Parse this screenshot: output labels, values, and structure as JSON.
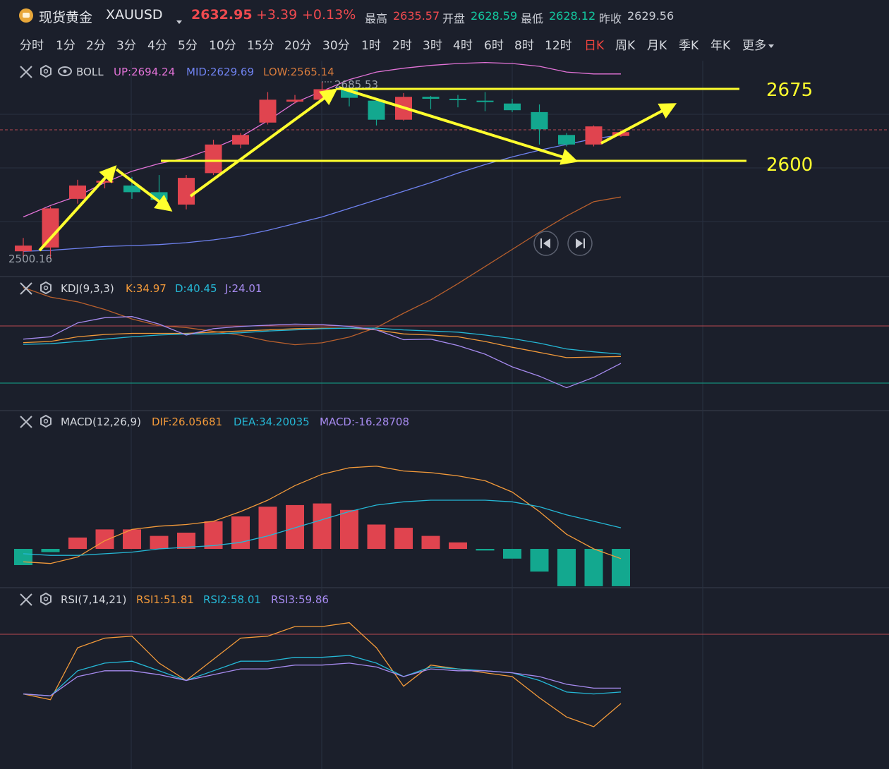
{
  "header": {
    "symbol_name": "现货黄金",
    "symbol_code": "XAUUSD",
    "price": "2632.95",
    "change": "+3.39",
    "change_pct": "+0.13%",
    "high_label": "最高",
    "high": "2635.57",
    "open_label": "开盘",
    "open": "2628.59",
    "low_label": "最低",
    "low": "2628.12",
    "prev_label": "昨收",
    "prev": "2629.56"
  },
  "periods": [
    "分时",
    "1分",
    "2分",
    "3分",
    "4分",
    "5分",
    "10分",
    "15分",
    "20分",
    "30分",
    "1时",
    "2时",
    "3时",
    "4时",
    "6时",
    "8时",
    "12时",
    "日K",
    "周K",
    "月K",
    "季K",
    "年K",
    "更多"
  ],
  "active_period": "日K",
  "colors": {
    "up": "#e0444f",
    "down": "#13a88f",
    "annotation": "#ffff2e",
    "background": "#1b1f2b"
  },
  "panels": {
    "boll": {
      "name": "BOLL",
      "up": "UP:2694.24",
      "mid": "MID:2629.69",
      "low": "LOW:2565.14"
    },
    "kdj": {
      "name": "KDJ(9,3,3)",
      "k": "K:34.97",
      "d": "D:40.45",
      "j": "J:24.01"
    },
    "macd": {
      "name": "MACD(12,26,9)",
      "dif": "DIF:26.05681",
      "dea": "DEA:34.20035",
      "macd": "MACD:-16.28708"
    },
    "rsi": {
      "name": "RSI(7,14,21)",
      "rsi1": "RSI1:51.81",
      "rsi2": "RSI2:58.01",
      "rsi3": "RSI3:59.86"
    }
  },
  "annotations": {
    "level_high": "2675",
    "level_low": "2600",
    "max_label": "2685.53",
    "min_label": "2500.16"
  },
  "chart_data": {
    "type": "candlestick",
    "candles": [
      {
        "o": 2508,
        "c": 2514,
        "h": 2522,
        "l": 2502
      },
      {
        "o": 2512,
        "c": 2553,
        "h": 2555,
        "l": 2500
      },
      {
        "o": 2563,
        "c": 2577,
        "h": 2583,
        "l": 2558
      },
      {
        "o": 2580,
        "c": 2582,
        "h": 2584,
        "l": 2574
      },
      {
        "o": 2577,
        "c": 2570,
        "h": 2586,
        "l": 2563
      },
      {
        "o": 2570,
        "c": 2562,
        "h": 2588,
        "l": 2556
      },
      {
        "o": 2557,
        "c": 2585,
        "h": 2588,
        "l": 2552
      },
      {
        "o": 2590,
        "c": 2620,
        "h": 2625,
        "l": 2588
      },
      {
        "o": 2620,
        "c": 2630,
        "h": 2632,
        "l": 2616
      },
      {
        "o": 2643,
        "c": 2667,
        "h": 2675,
        "l": 2641
      },
      {
        "o": 2665,
        "c": 2667,
        "h": 2672,
        "l": 2663
      },
      {
        "o": 2667,
        "c": 2678,
        "h": 2685.5,
        "l": 2665
      },
      {
        "o": 2678,
        "c": 2669,
        "h": 2682,
        "l": 2660
      },
      {
        "o": 2666,
        "c": 2646,
        "h": 2668,
        "l": 2640
      },
      {
        "o": 2646,
        "c": 2670,
        "h": 2674,
        "l": 2645
      },
      {
        "o": 2670,
        "c": 2668,
        "h": 2671,
        "l": 2657
      },
      {
        "o": 2668,
        "c": 2667,
        "h": 2672,
        "l": 2659
      },
      {
        "o": 2666,
        "c": 2665,
        "h": 2675,
        "l": 2655
      },
      {
        "o": 2663,
        "c": 2656,
        "h": 2668,
        "l": 2654
      },
      {
        "o": 2654,
        "c": 2636,
        "h": 2662,
        "l": 2620
      },
      {
        "o": 2630,
        "c": 2620,
        "h": 2632,
        "l": 2618
      },
      {
        "o": 2620,
        "c": 2639,
        "h": 2640,
        "l": 2618
      },
      {
        "o": 2629,
        "c": 2633,
        "h": 2636,
        "l": 2628
      }
    ],
    "boll_up": [
      2544,
      2556,
      2566,
      2580,
      2592,
      2600,
      2606,
      2616,
      2628,
      2645,
      2664,
      2676,
      2688,
      2696,
      2700,
      2703,
      2705,
      2706,
      2705,
      2702,
      2696,
      2694,
      2694
    ],
    "boll_mid": [
      2508,
      2509,
      2511,
      2513,
      2514,
      2515,
      2517,
      2520,
      2524,
      2530,
      2537,
      2544,
      2553,
      2562,
      2571,
      2580,
      2590,
      2599,
      2607,
      2614,
      2620,
      2626,
      2630
    ],
    "boll_low": [
      2470,
      2460,
      2455,
      2447,
      2437,
      2430,
      2428,
      2424,
      2420,
      2414,
      2410,
      2412,
      2418,
      2428,
      2443,
      2457,
      2474,
      2492,
      2510,
      2528,
      2545,
      2560,
      2565
    ],
    "kdj_k": [
      60,
      62,
      70,
      74,
      76,
      76,
      76,
      78,
      80,
      82,
      84,
      85,
      85,
      82,
      75,
      73,
      70,
      62,
      52,
      43,
      34,
      35,
      36
    ],
    "kdj_d": [
      57,
      58,
      62,
      66,
      70,
      73,
      75,
      75,
      77,
      80,
      82,
      84,
      85,
      85,
      82,
      80,
      78,
      73,
      67,
      59,
      49,
      44,
      40
    ],
    "kdj_j": [
      66,
      70,
      94,
      103,
      105,
      92,
      73,
      84,
      88,
      90,
      92,
      91,
      88,
      82,
      65,
      66,
      55,
      40,
      18,
      2,
      -18,
      0,
      24
    ],
    "macd_dif": [
      -8,
      -9,
      -5,
      5,
      12,
      14,
      15,
      17,
      23,
      30,
      39,
      46,
      50,
      51,
      48,
      47,
      45,
      42,
      35,
      23,
      9,
      0,
      -6
    ],
    "macd_dea": [
      -3,
      -4,
      -4,
      -3,
      -2,
      0,
      1,
      2,
      4,
      8,
      13,
      18,
      23,
      27,
      29,
      30,
      30,
      30,
      29,
      26,
      21,
      17,
      13
    ],
    "macd_hist": [
      -10,
      -2,
      7,
      12,
      12,
      8,
      10,
      17,
      20,
      26,
      27,
      28,
      24,
      15,
      13,
      8,
      4,
      -1,
      -6,
      -14,
      -23,
      -23,
      -23
    ],
    "rsi1": [
      57,
      54,
      81,
      86,
      87,
      73,
      64,
      75,
      86,
      87,
      92,
      92,
      94,
      81,
      61,
      72,
      70,
      68,
      66,
      55,
      45,
      40,
      52
    ],
    "rsi2": [
      57,
      56,
      69,
      73,
      74,
      69,
      64,
      69,
      74,
      74,
      76,
      76,
      77,
      73,
      66,
      71,
      70,
      69,
      68,
      64,
      58,
      57,
      58
    ],
    "rsi3": [
      57,
      56,
      66,
      69,
      69,
      67,
      64,
      67,
      70,
      70,
      72,
      72,
      73,
      71,
      66,
      70,
      69,
      69,
      68,
      66,
      62,
      60,
      60
    ]
  }
}
